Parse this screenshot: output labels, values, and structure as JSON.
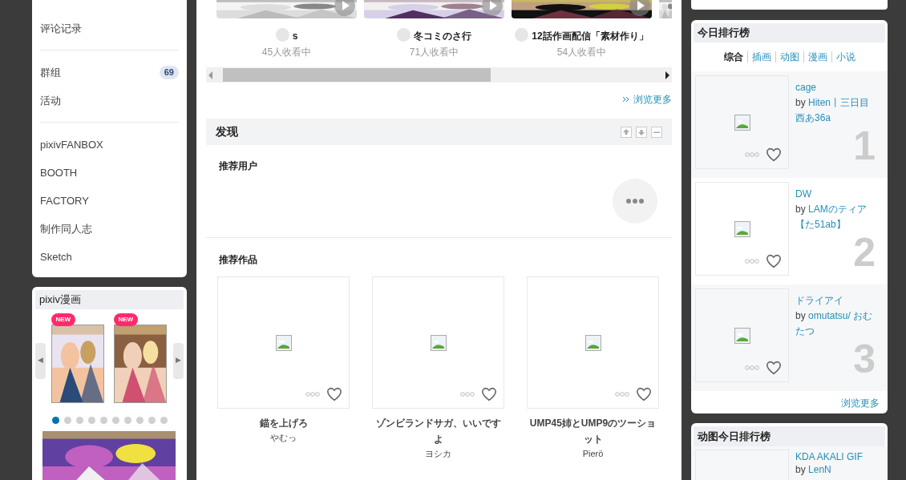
{
  "sidebar": {
    "groups": [
      [
        {
          "label": "评论记录"
        }
      ],
      [
        {
          "label": "群组",
          "badge": "69"
        },
        {
          "label": "活动"
        }
      ],
      [
        {
          "label": "pixivFANBOX"
        },
        {
          "label": "BOOTH"
        },
        {
          "label": "FACTORY"
        },
        {
          "label": "制作同人志"
        },
        {
          "label": "Sketch"
        }
      ]
    ]
  },
  "manga": {
    "title": "pixiv漫画",
    "badges": [
      "NEW",
      "NEW"
    ],
    "arrows": {
      "prev": "◀",
      "next": "▶"
    },
    "dots": [
      {
        "selected": true
      },
      {
        "selected": false
      },
      {
        "selected": false
      },
      {
        "selected": false
      },
      {
        "selected": false
      },
      {
        "selected": false
      },
      {
        "selected": false
      },
      {
        "selected": false
      },
      {
        "selected": false
      },
      {
        "selected": false
      }
    ]
  },
  "live": {
    "items": [
      {
        "title": "s",
        "viewers": "45人收看中"
      },
      {
        "title": "冬コミのさ行",
        "viewers": "71人收看中"
      },
      {
        "title": "12話作画配信「素材作り」",
        "viewers": "54人收看中"
      }
    ],
    "more": "浏览更多"
  },
  "discover": {
    "title": "发现",
    "users_title": "推荐用户",
    "works_title": "推荐作品",
    "works": [
      {
        "title": "錨を上げろ",
        "author": "やむっ"
      },
      {
        "title": "ゾンビランドサガ、いいですよ",
        "author": "ヨシカ"
      },
      {
        "title": "UMP45姉とUMP9のツーショット",
        "author": "Pierö"
      }
    ]
  },
  "ranking": {
    "title": "今日排行榜",
    "tabs": [
      {
        "label": "综合",
        "selected": true
      },
      {
        "label": "插画",
        "selected": false
      },
      {
        "label": "动图",
        "selected": false
      },
      {
        "label": "漫画",
        "selected": false
      },
      {
        "label": "小说",
        "selected": false
      }
    ],
    "items": [
      {
        "title": "cage",
        "by": "by",
        "author": "Hiten丨三日目西あ36a",
        "rank": "1"
      },
      {
        "title": "DW",
        "by": "by",
        "author": "LAMのティア【た51ab】",
        "rank": "2"
      },
      {
        "title": "ドライアイ",
        "by": "by",
        "author": "omutatsu/ おむたつ",
        "rank": "3"
      }
    ],
    "more": "浏览更多"
  },
  "ugoira_ranking": {
    "title": "动图今日排行榜",
    "items": [
      {
        "title": "KDA AKALI GIF",
        "by": "by",
        "author": "LenN"
      }
    ]
  }
}
